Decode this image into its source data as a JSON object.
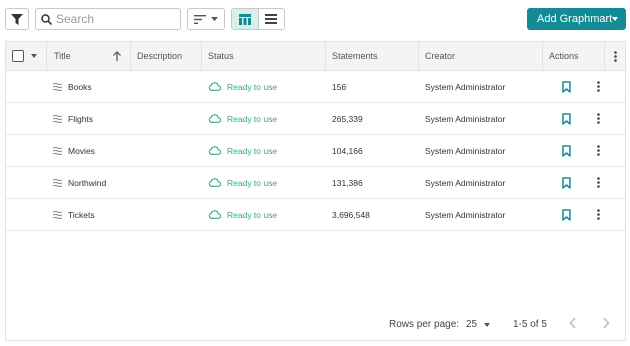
{
  "toolbar": {
    "search_placeholder": "Search",
    "add_button_label": "Add Graphmart"
  },
  "table": {
    "columns": [
      "Title",
      "Description",
      "Status",
      "Statements",
      "Creator",
      "Actions"
    ],
    "rows": [
      {
        "title": "Books",
        "description": "",
        "status": "Ready to use",
        "statements": "156",
        "creator": "System Administrator"
      },
      {
        "title": "Flights",
        "description": "",
        "status": "Ready to use",
        "statements": "265,339",
        "creator": "System Administrator"
      },
      {
        "title": "Movies",
        "description": "",
        "status": "Ready to use",
        "statements": "104,166",
        "creator": "System Administrator"
      },
      {
        "title": "Northwind",
        "description": "",
        "status": "Ready to use",
        "statements": "131,386",
        "creator": "System Administrator"
      },
      {
        "title": "Tickets",
        "description": "",
        "status": "Ready to use",
        "statements": "3,696,548",
        "creator": "System Administrator"
      }
    ]
  },
  "pagination": {
    "rows_per_page_label": "Rows per page:",
    "rows_per_page_value": "25",
    "range": "1-5 of 5"
  },
  "colors": {
    "accent": "#138b95",
    "status_ready": "#31a88a",
    "bookmark": "#138b95",
    "active_view_bg": "#d7f0ee"
  },
  "icons": {
    "filter": "filter-icon",
    "search": "search-icon",
    "sort": "sort-icon",
    "table_view": "table-view-icon",
    "list_view": "list-view-icon",
    "graphmart": "graphmart-layers-icon",
    "status": "cloud-icon",
    "bookmark": "bookmark-icon",
    "more": "more-vertical-icon"
  }
}
